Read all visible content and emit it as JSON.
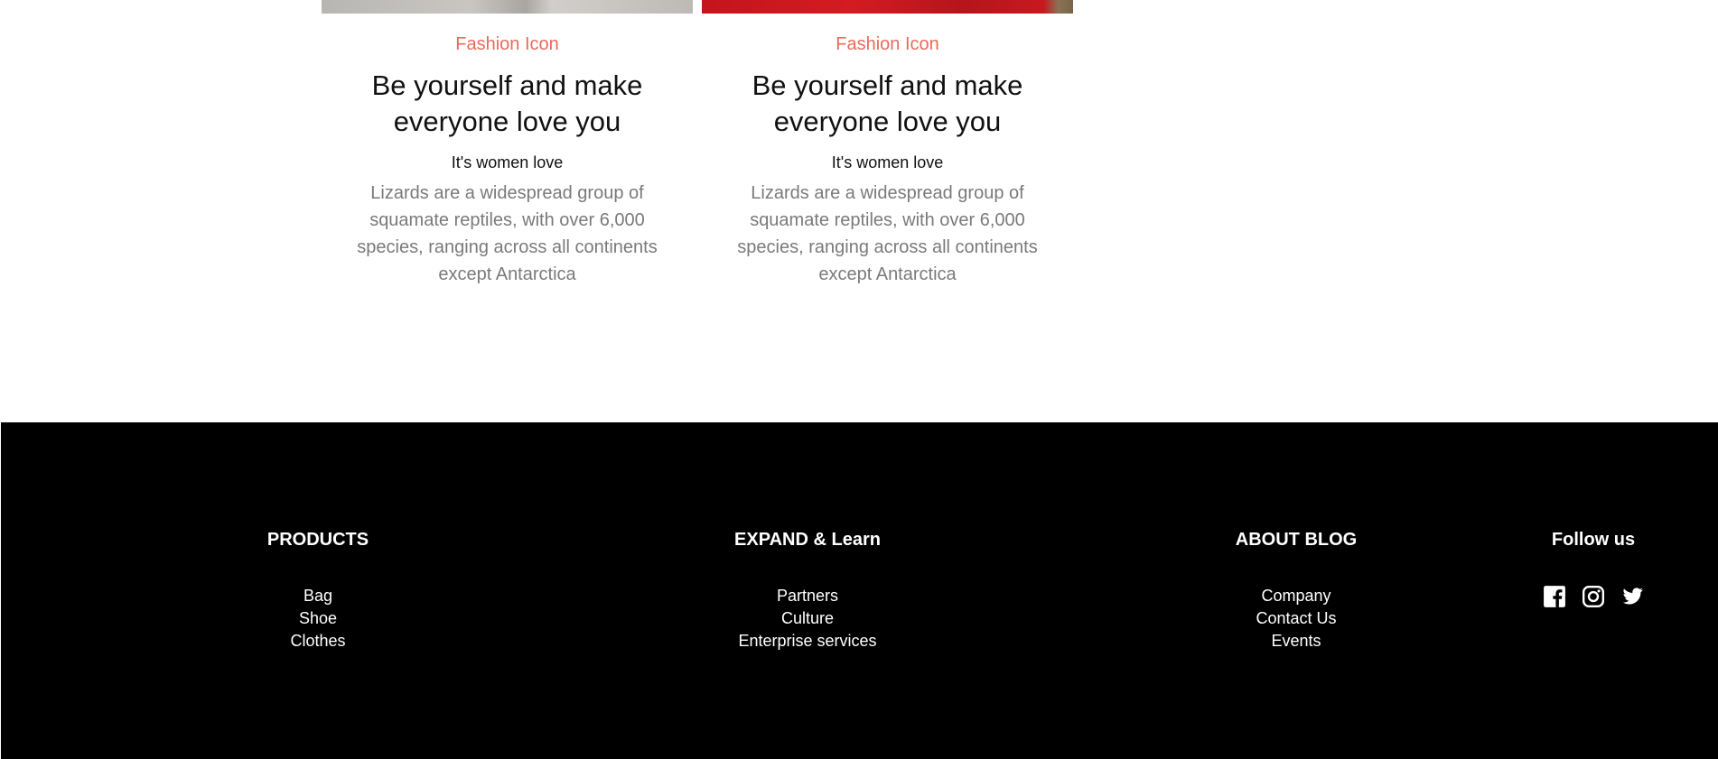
{
  "cards": [
    {
      "category": "Fashion Icon",
      "title": "Be yourself and make everyone love you",
      "subtitle": "It's women love",
      "text": "Lizards are a widespread group of squamate reptiles, with over 6,000 species, ranging across all continents except Antarctica"
    },
    {
      "category": "Fashion Icon",
      "title": "Be yourself and make everyone love you",
      "subtitle": "It's women love",
      "text": "Lizards are a widespread group of squamate reptiles, with over 6,000 species, ranging across all continents except Antarctica"
    }
  ],
  "footer": {
    "products": {
      "heading": "PRODUCTS",
      "links": [
        "Bag",
        "Shoe",
        "Clothes"
      ]
    },
    "expand": {
      "heading": "EXPAND & Learn",
      "links": [
        "Partners",
        "Culture",
        "Enterprise services"
      ]
    },
    "about": {
      "heading": "ABOUT BLOG",
      "links": [
        "Company",
        "Contact Us",
        "Events"
      ]
    },
    "follow": {
      "heading": "Follow us",
      "icons": [
        "facebook-icon",
        "instagram-icon",
        "twitter-icon"
      ]
    }
  },
  "colors": {
    "accent": "#e96a5a",
    "footer_bg": "#000000",
    "body_text": "#7a7a7a"
  }
}
